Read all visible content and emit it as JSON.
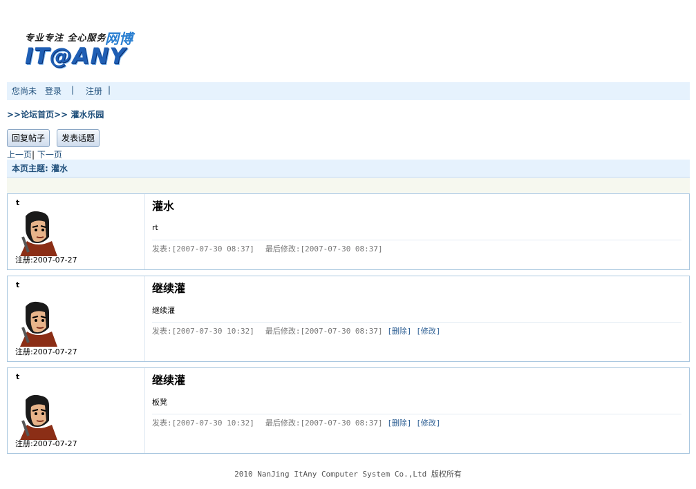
{
  "logo": {
    "slogan": "专业专注 全心服务",
    "slogan_accent": "网博",
    "brand": "IT@ANY"
  },
  "userbar": {
    "status": "您尚未",
    "login": "登录",
    "sep1": "|",
    "register": "注册",
    "sep2": "|"
  },
  "breadcrumb": {
    "prefix1": ">>",
    "home": "论坛首页",
    "prefix2": ">>",
    "board": "灌水乐园"
  },
  "buttons": {
    "reply": "回复帖子",
    "new_topic": "发表话题"
  },
  "pager": {
    "prev": "上一页",
    "sep": "|",
    "next": "下一页"
  },
  "topic": {
    "label": "本页主题: 灌水"
  },
  "posts": [
    {
      "user": "t",
      "reg": "注册:2007-07-27",
      "title": "灌水",
      "content": "rt",
      "posted": "发表:[2007-07-30 08:37]",
      "modified": "最后修改:[2007-07-30 08:37]",
      "delete": "",
      "edit": ""
    },
    {
      "user": "t",
      "reg": "注册:2007-07-27",
      "title": "继续灌",
      "content": "继续灌",
      "posted": "发表:[2007-07-30 10:32]",
      "modified": "最后修改:[2007-07-30 08:37]",
      "delete": "[删除]",
      "edit": "[修改]"
    },
    {
      "user": "t",
      "reg": "注册:2007-07-27",
      "title": "继续灌",
      "content": "板凳",
      "posted": "发表:[2007-07-30 10:32]",
      "modified": "最后修改:[2007-07-30 08:37]",
      "delete": "[删除]",
      "edit": "[修改]"
    }
  ],
  "footer": {
    "text": "2010 NanJing ItAny Computer System Co.,Ltd 版权所有"
  },
  "colors": {
    "link": "#1e4e7a",
    "bar_bg": "#e6f2fd",
    "border": "#a9c7df"
  }
}
